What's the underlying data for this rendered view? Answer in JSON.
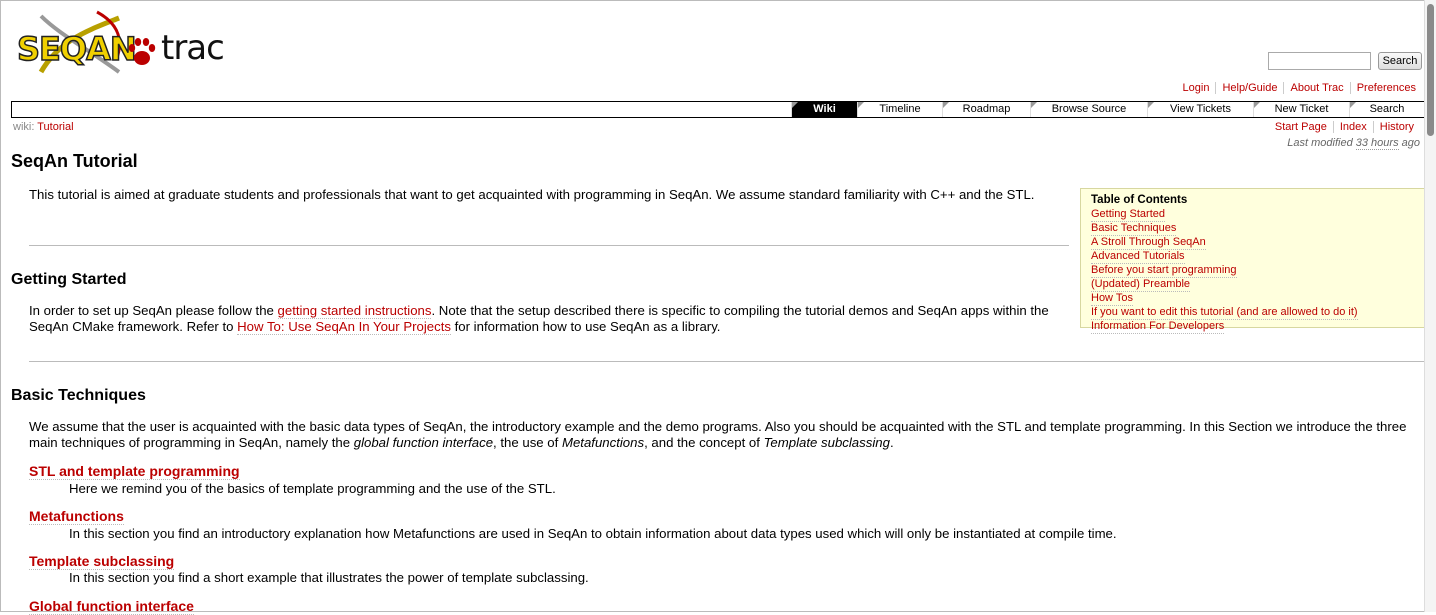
{
  "logo": {
    "brand": "SEQAN",
    "product": "trac"
  },
  "search": {
    "placeholder": "",
    "button_label": "Search"
  },
  "metanav": [
    "Login",
    "Help/Guide",
    "About Trac",
    "Preferences"
  ],
  "mainnav": [
    "Wiki",
    "Timeline",
    "Roadmap",
    "Browse Source",
    "View Tickets",
    "New Ticket",
    "Search"
  ],
  "breadcrumb": {
    "prefix": "wiki:",
    "page": "Tutorial"
  },
  "ctxtnav": [
    "Start Page",
    "Index",
    "History"
  ],
  "lastmod": {
    "prefix": "Last modified",
    "when": "33 hours",
    "suffix": "ago"
  },
  "page": {
    "title": "SeqAn Tutorial",
    "intro": "This tutorial is aimed at graduate students and professionals that want to get acquainted with programming in SeqAn. We assume standard familiarity with C++ and the STL."
  },
  "toc": {
    "title": "Table of Contents",
    "items": [
      "Getting Started",
      "Basic Techniques",
      "A Stroll Through SeqAn",
      "Advanced Tutorials",
      "Before you start programming",
      "(Updated) Preamble",
      "How Tos",
      "If you want to edit this tutorial (and are allowed to do it)",
      "Information For Developers"
    ]
  },
  "getting_started": {
    "heading": "Getting Started",
    "text1": "In order to set up SeqAn please follow the ",
    "link1": "getting started instructions",
    "text2": ". Note that the setup described there is specific to compiling the tutorial demos and SeqAn apps within the SeqAn CMake framework. Refer to ",
    "link2": "How To: Use SeqAn In Your Projects",
    "text3": " for information how to use SeqAn as a library."
  },
  "basic_techniques": {
    "heading": "Basic Techniques",
    "text1": "We assume that the user is acquainted with the basic data types of SeqAn, the introductory example and the demo programs. Also you should be acquainted with the STL and template programming. In this Section we introduce the three main techniques of programming in SeqAn, namely the ",
    "em1": "global function interface",
    "text2": ", the use of ",
    "em2": "Metafunctions",
    "text3": ", and the concept of ",
    "em3": "Template subclassing",
    "text4": ".",
    "items": [
      {
        "title": "STL and template programming",
        "desc": "Here we remind you of the basics of template programming and the use of the STL."
      },
      {
        "title": "Metafunctions",
        "desc": "In this section you find an introductory explanation how Metafunctions are used in SeqAn to obtain information about data types used which will only be instantiated at compile time."
      },
      {
        "title": "Template subclassing",
        "desc": "In this section you find a short example that illustrates the power of template subclassing."
      },
      {
        "title": "Global function interface",
        "desc": ""
      }
    ]
  }
}
